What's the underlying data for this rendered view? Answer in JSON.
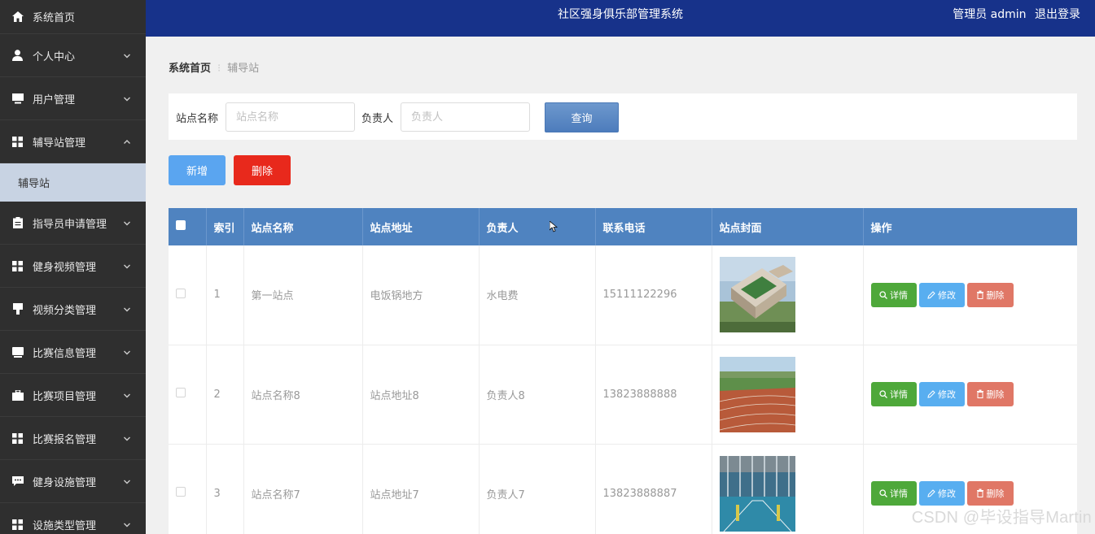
{
  "header": {
    "title": "社区强身俱乐部管理系统",
    "user_label": "管理员 admin",
    "logout_label": "退出登录",
    "bg_color": "#17328a"
  },
  "sidebar": {
    "items": [
      {
        "label": "系统首页",
        "icon": "home-icon"
      },
      {
        "label": "个人中心",
        "icon": "person-icon"
      },
      {
        "label": "用户管理",
        "icon": "monitor-icon"
      },
      {
        "label": "辅导站管理",
        "icon": "grid-icon",
        "expanded": true
      },
      {
        "label": "指导员申请管理",
        "icon": "clipboard-icon"
      },
      {
        "label": "健身视频管理",
        "icon": "grid-icon"
      },
      {
        "label": "视频分类管理",
        "icon": "funnel-icon"
      },
      {
        "label": "比赛信息管理",
        "icon": "desktop-icon"
      },
      {
        "label": "比赛项目管理",
        "icon": "briefcase-icon"
      },
      {
        "label": "比赛报名管理",
        "icon": "grid-icon"
      },
      {
        "label": "健身设施管理",
        "icon": "chat-icon"
      },
      {
        "label": "设施类型管理",
        "icon": "grid-icon"
      }
    ],
    "sub_item": "辅导站"
  },
  "breadcrumb": {
    "home": "系统首页",
    "separator": "⁝",
    "current": "辅导站"
  },
  "search": {
    "name_label": "站点名称",
    "name_placeholder": "站点名称",
    "owner_label": "负责人",
    "owner_placeholder": "负责人",
    "query_button": "查询"
  },
  "actions": {
    "add": "新增",
    "delete": "删除"
  },
  "table": {
    "columns": [
      "",
      "索引",
      "站点名称",
      "站点地址",
      "负责人",
      "联系电话",
      "站点封面",
      "操作"
    ],
    "rows": [
      {
        "index": "1",
        "name": "第一站点",
        "address": "电饭锅地方",
        "owner": "水电费",
        "phone": "15111122296",
        "cover": "campus-aerial-image"
      },
      {
        "index": "2",
        "name": "站点名称8",
        "address": "站点地址8",
        "owner": "负责人8",
        "phone": "13823888888",
        "cover": "running-track-image"
      },
      {
        "index": "3",
        "name": "站点名称7",
        "address": "站点地址7",
        "owner": "负责人7",
        "phone": "13823888887",
        "cover": "indoor-court-image"
      }
    ],
    "op_labels": {
      "detail": "详情",
      "edit": "修改",
      "remove": "删除"
    }
  },
  "colors": {
    "table_header": "#4f83c0",
    "detail_btn": "#4ea83a",
    "edit_btn": "#58aef0",
    "remove_btn": "#e07766",
    "add_btn": "#5aa5f0",
    "delete_btn": "#e8291c"
  },
  "watermark": "CSDN @毕设指导Martin"
}
